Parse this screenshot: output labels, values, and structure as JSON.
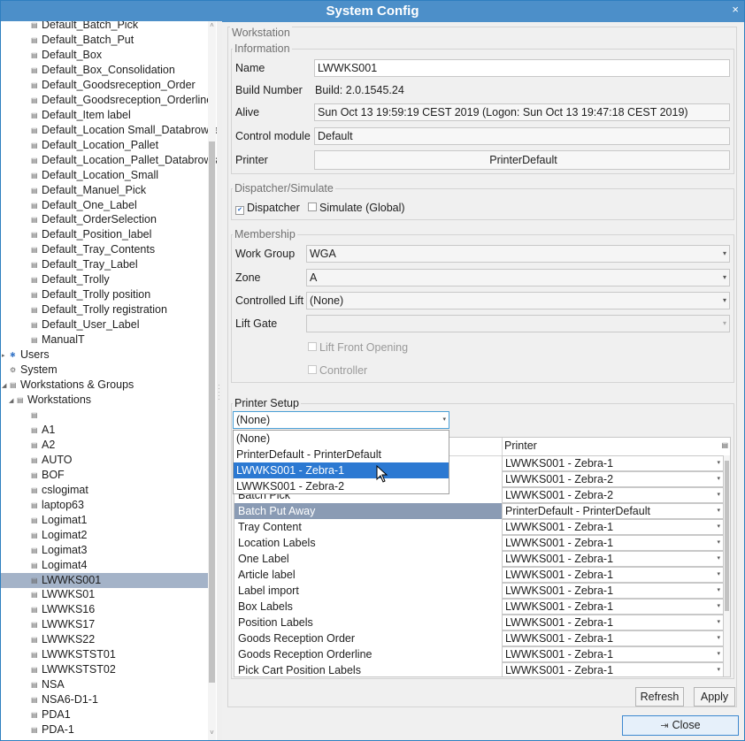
{
  "window": {
    "title": "System Config",
    "close_glyph": "×"
  },
  "tree": {
    "items": [
      {
        "label": "Default_Batch_Pick",
        "level": 4,
        "icon": "document-icon"
      },
      {
        "label": "Default_Batch_Put",
        "level": 4,
        "icon": "document-icon"
      },
      {
        "label": "Default_Box",
        "level": 4,
        "icon": "document-icon"
      },
      {
        "label": "Default_Box_Consolidation",
        "level": 4,
        "icon": "document-icon"
      },
      {
        "label": "Default_Goodsreception_Order",
        "level": 4,
        "icon": "document-icon"
      },
      {
        "label": "Default_Goodsreception_Orderline",
        "level": 4,
        "icon": "document-icon"
      },
      {
        "label": "Default_Item label",
        "level": 4,
        "icon": "document-icon"
      },
      {
        "label": "Default_Location Small_Databrowser",
        "level": 4,
        "icon": "document-icon"
      },
      {
        "label": "Default_Location_Pallet",
        "level": 4,
        "icon": "document-icon"
      },
      {
        "label": "Default_Location_Pallet_Databrowser",
        "level": 4,
        "icon": "document-icon"
      },
      {
        "label": "Default_Location_Small",
        "level": 4,
        "icon": "document-icon"
      },
      {
        "label": "Default_Manuel_Pick",
        "level": 4,
        "icon": "document-icon"
      },
      {
        "label": "Default_One_Label",
        "level": 4,
        "icon": "document-icon"
      },
      {
        "label": "Default_OrderSelection",
        "level": 4,
        "icon": "document-icon"
      },
      {
        "label": "Default_Position_label",
        "level": 4,
        "icon": "document-icon"
      },
      {
        "label": "Default_Tray_Contents",
        "level": 4,
        "icon": "document-icon"
      },
      {
        "label": "Default_Tray_Label",
        "level": 4,
        "icon": "document-icon"
      },
      {
        "label": "Default_Trolly",
        "level": 4,
        "icon": "document-icon"
      },
      {
        "label": "Default_Trolly position",
        "level": 4,
        "icon": "document-icon"
      },
      {
        "label": "Default_Trolly registration",
        "level": 4,
        "icon": "document-icon"
      },
      {
        "label": "Default_User_Label",
        "level": 4,
        "icon": "document-icon"
      },
      {
        "label": "ManualT",
        "level": 4,
        "icon": "document-icon"
      },
      {
        "label": "Users",
        "level": 1,
        "icon": "users-icon",
        "arrow": "collapsed"
      },
      {
        "label": "System",
        "level": 1,
        "icon": "gear-icon"
      },
      {
        "label": "Workstations & Groups",
        "level": 1,
        "icon": "workstations-icon",
        "arrow": "expanded"
      },
      {
        "label": "Workstations",
        "level": 2,
        "icon": "workstations-icon",
        "arrow": "expanded"
      },
      {
        "label": "",
        "level": 3,
        "icon": "workstation-icon"
      },
      {
        "label": "A1",
        "level": 3,
        "icon": "workstation-icon"
      },
      {
        "label": "A2",
        "level": 3,
        "icon": "workstation-icon"
      },
      {
        "label": "AUTO",
        "level": 3,
        "icon": "workstation-icon"
      },
      {
        "label": "BOF",
        "level": 3,
        "icon": "workstation-icon"
      },
      {
        "label": "cslogimat",
        "level": 3,
        "icon": "workstation-icon"
      },
      {
        "label": "laptop63",
        "level": 3,
        "icon": "workstation-icon"
      },
      {
        "label": "Logimat1",
        "level": 3,
        "icon": "workstation-icon"
      },
      {
        "label": "Logimat2",
        "level": 3,
        "icon": "workstation-icon"
      },
      {
        "label": "Logimat3",
        "level": 3,
        "icon": "workstation-icon"
      },
      {
        "label": "Logimat4",
        "level": 3,
        "icon": "workstation-icon"
      },
      {
        "label": "LWWKS001",
        "level": 3,
        "icon": "workstation-icon",
        "selected": true
      },
      {
        "label": "LWWKS01",
        "level": 3,
        "icon": "workstation-icon"
      },
      {
        "label": "LWWKS16",
        "level": 3,
        "icon": "workstation-icon"
      },
      {
        "label": "LWWKS17",
        "level": 3,
        "icon": "workstation-icon"
      },
      {
        "label": "LWWKS22",
        "level": 3,
        "icon": "workstation-icon"
      },
      {
        "label": "LWWKSTST01",
        "level": 3,
        "icon": "workstation-icon"
      },
      {
        "label": "LWWKSTST02",
        "level": 3,
        "icon": "workstation-icon"
      },
      {
        "label": "NSA",
        "level": 3,
        "icon": "workstation-icon"
      },
      {
        "label": "NSA6-D1-1",
        "level": 3,
        "icon": "workstation-icon"
      },
      {
        "label": "PDA1",
        "level": 3,
        "icon": "workstation-icon"
      },
      {
        "label": "PDA-1",
        "level": 3,
        "icon": "workstation-icon"
      }
    ]
  },
  "workstation": {
    "legend": "Workstation",
    "information": {
      "legend": "Information",
      "name_label": "Name",
      "name_value": "LWWKS001",
      "build_label": "Build Number",
      "build_value": "Build: 2.0.1545.24",
      "alive_label": "Alive",
      "alive_value": "Sun Oct 13 19:59:19 CEST 2019  (Logon: Sun Oct 13 19:47:18 CEST 2019)",
      "control_label": "Control module",
      "control_value": "Default",
      "printer_label": "Printer",
      "printer_value": "PrinterDefault"
    },
    "dispatcher": {
      "legend": "Dispatcher/Simulate",
      "dispatcher_label": "Dispatcher",
      "dispatcher_checked": true,
      "simulate_label": "Simulate (Global)",
      "simulate_checked": false
    },
    "membership": {
      "legend": "Membership",
      "workgroup_label": "Work Group",
      "workgroup_value": "WGA",
      "zone_label": "Zone",
      "zone_value": "A",
      "lift_label": "Controlled Lift",
      "lift_value": "(None)",
      "liftgate_label": "Lift Gate",
      "liftgate_value": "",
      "lift_front_label": "Lift Front Opening",
      "controller_label": "Controller"
    },
    "printer_setup": {
      "legend": "Printer Setup",
      "combo_value": "(None)",
      "options": [
        {
          "label": "(None)"
        },
        {
          "label": "PrinterDefault - PrinterDefault"
        },
        {
          "label": "LWWKS001 - Zebra-1",
          "selected": true
        },
        {
          "label": "LWWKS001 - Zebra-2"
        }
      ],
      "col_printer": "Printer",
      "rows": [
        {
          "task": "",
          "printer": "LWWKS001 - Zebra-1"
        },
        {
          "task": "",
          "printer": "LWWKS001 - Zebra-2"
        },
        {
          "task": "Batch Pick",
          "printer": "LWWKS001 - Zebra-2"
        },
        {
          "task": "Batch Put Away",
          "printer": "PrinterDefault - PrinterDefault",
          "highlighted": true
        },
        {
          "task": "Tray Content",
          "printer": "LWWKS001 - Zebra-1"
        },
        {
          "task": "Location Labels",
          "printer": "LWWKS001 - Zebra-1"
        },
        {
          "task": "One Label",
          "printer": "LWWKS001 - Zebra-1"
        },
        {
          "task": "Article label",
          "printer": "LWWKS001 - Zebra-1"
        },
        {
          "task": "Label import",
          "printer": "LWWKS001 - Zebra-1"
        },
        {
          "task": "Box Labels",
          "printer": "LWWKS001 - Zebra-1"
        },
        {
          "task": "Position Labels",
          "printer": "LWWKS001 - Zebra-1"
        },
        {
          "task": "Goods Reception Order",
          "printer": "LWWKS001 - Zebra-1"
        },
        {
          "task": "Goods Reception Orderline",
          "printer": "LWWKS001 - Zebra-1"
        },
        {
          "task": "Pick Cart Position Labels",
          "printer": "LWWKS001 - Zebra-1"
        }
      ]
    }
  },
  "buttons": {
    "refresh": "Refresh",
    "apply": "Apply",
    "close": "Close"
  },
  "colors": {
    "titlebar": "#4c8fc9",
    "selection": "#2c79d2",
    "tree_selected": "#a4b3c8",
    "row_highlight": "#8a9bb4"
  }
}
